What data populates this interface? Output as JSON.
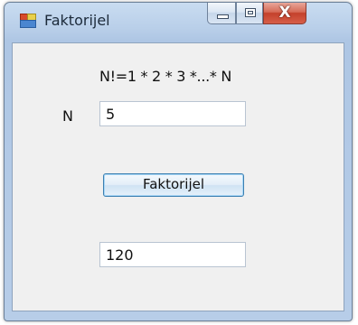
{
  "window": {
    "title": "Faktorijel",
    "close_glyph": "X"
  },
  "form": {
    "formula_label": "N!=1 * 2 * 3 *...* N",
    "n_label": "N",
    "n_value": "5",
    "button_label": "Faktorijel",
    "result_value": "120"
  },
  "colors": {
    "close_button": "#c4412c",
    "button_border": "#3c7fb1",
    "client_bg": "#f0f0f0"
  }
}
